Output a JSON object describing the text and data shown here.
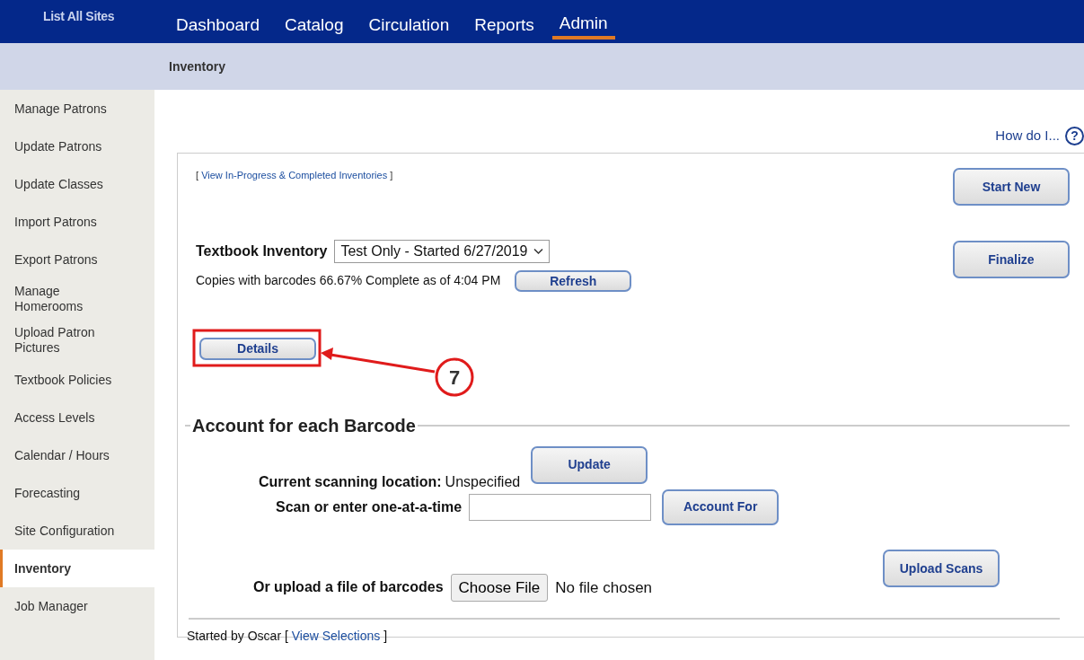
{
  "header": {
    "site_link": "List All Sites",
    "tabs": [
      {
        "label": "Dashboard",
        "selected": false
      },
      {
        "label": "Catalog",
        "selected": false
      },
      {
        "label": "Circulation",
        "selected": false
      },
      {
        "label": "Reports",
        "selected": false
      },
      {
        "label": "Admin",
        "selected": true
      }
    ]
  },
  "breadcrumb": "Inventory",
  "sidebar": {
    "items": [
      {
        "label": "Manage Patrons",
        "selected": false
      },
      {
        "label": "Update Patrons",
        "selected": false
      },
      {
        "label": "Update Classes",
        "selected": false
      },
      {
        "label": "Import Patrons",
        "selected": false
      },
      {
        "label": "Export Patrons",
        "selected": false
      },
      {
        "label": "Manage Homerooms",
        "selected": false
      },
      {
        "label": "Upload Patron Pictures",
        "selected": false
      },
      {
        "label": "Textbook Policies",
        "selected": false
      },
      {
        "label": "Access Levels",
        "selected": false
      },
      {
        "label": "Calendar / Hours",
        "selected": false
      },
      {
        "label": "Forecasting",
        "selected": false
      },
      {
        "label": "Site Configuration",
        "selected": false
      },
      {
        "label": "Inventory",
        "selected": true
      },
      {
        "label": "Job Manager",
        "selected": false
      }
    ]
  },
  "help": {
    "label": "How do I...",
    "icon_text": "?"
  },
  "panel": {
    "view_link": {
      "before": "[ ",
      "link": "View In-Progress & Completed Inventories",
      "after": " ]"
    },
    "start_new_button": "Start New",
    "finalize_button": "Finalize",
    "inventory_label": "Textbook Inventory",
    "inventory_select": "Test Only - Started 6/27/2019",
    "status_text": "Copies with barcodes 66.67% Complete as of 4:04 PM",
    "refresh_button": "Refresh",
    "details_button": "Details",
    "section_title": "Account for each Barcode",
    "location_label": "Current scanning location:",
    "location_value": "Unspecified",
    "update_button": "Update",
    "scan_label": "Scan or enter one-at-a-time",
    "account_for_button": "Account For",
    "upload_label": "Or upload a file of barcodes",
    "choose_file_button": "Choose File",
    "file_status": "No file chosen",
    "upload_scans_button": "Upload Scans",
    "footer": {
      "started_by": "Started by Oscar",
      "before": "[ ",
      "link": "View Selections",
      "after": " ]"
    }
  },
  "annotation": {
    "step_number": "7"
  }
}
